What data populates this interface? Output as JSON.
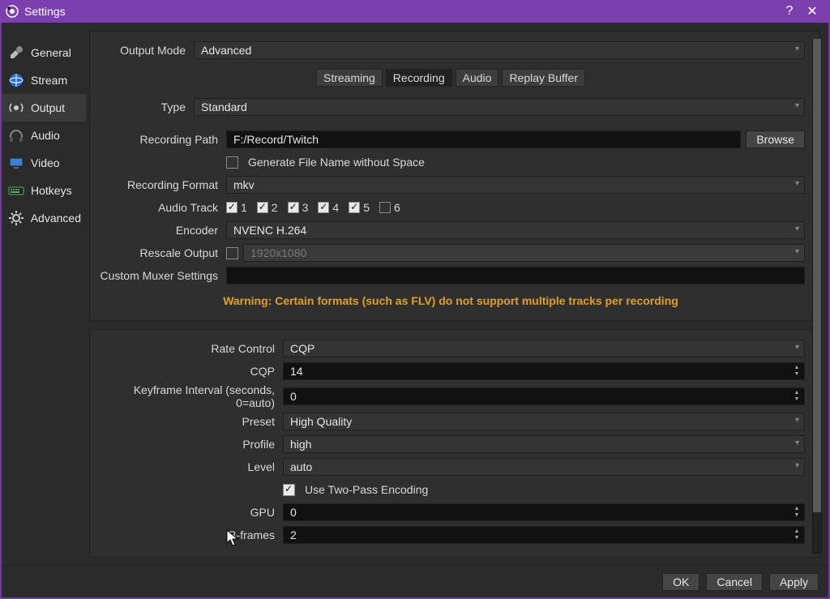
{
  "window": {
    "title": "Settings"
  },
  "sidebar": {
    "items": [
      {
        "label": "General"
      },
      {
        "label": "Stream"
      },
      {
        "label": "Output"
      },
      {
        "label": "Audio"
      },
      {
        "label": "Video"
      },
      {
        "label": "Hotkeys"
      },
      {
        "label": "Advanced"
      }
    ],
    "selected_index": 2
  },
  "tabs": {
    "items": [
      "Streaming",
      "Recording",
      "Audio",
      "Replay Buffer"
    ],
    "active_index": 1
  },
  "top": {
    "output_mode_label": "Output Mode",
    "output_mode_value": "Advanced"
  },
  "recording": {
    "type_label": "Type",
    "type_value": "Standard",
    "path_label": "Recording Path",
    "path_value": "F:/Record/Twitch",
    "browse_label": "Browse",
    "gen_no_space_checked": false,
    "gen_no_space_label": "Generate File Name without Space",
    "format_label": "Recording Format",
    "format_value": "mkv",
    "audio_track_label": "Audio Track",
    "tracks": [
      {
        "label": "1",
        "checked": true
      },
      {
        "label": "2",
        "checked": true
      },
      {
        "label": "3",
        "checked": true
      },
      {
        "label": "4",
        "checked": true
      },
      {
        "label": "5",
        "checked": true
      },
      {
        "label": "6",
        "checked": false
      }
    ],
    "encoder_label": "Encoder",
    "encoder_value": "NVENC H.264",
    "rescale_label": "Rescale Output",
    "rescale_checked": false,
    "rescale_value": "1920x1080",
    "muxer_label": "Custom Muxer Settings",
    "muxer_value": "",
    "warning": "Warning: Certain formats (such as FLV) do not support multiple tracks per recording"
  },
  "encoder": {
    "rate_control_label": "Rate Control",
    "rate_control_value": "CQP",
    "cqp_label": "CQP",
    "cqp_value": "14",
    "keyframe_label": "Keyframe Interval (seconds, 0=auto)",
    "keyframe_value": "0",
    "preset_label": "Preset",
    "preset_value": "High Quality",
    "profile_label": "Profile",
    "profile_value": "high",
    "level_label": "Level",
    "level_value": "auto",
    "two_pass_checked": true,
    "two_pass_label": "Use Two-Pass Encoding",
    "gpu_label": "GPU",
    "gpu_value": "0",
    "bframes_label": "B-frames",
    "bframes_value": "2"
  },
  "footer": {
    "ok": "OK",
    "cancel": "Cancel",
    "apply": "Apply"
  }
}
